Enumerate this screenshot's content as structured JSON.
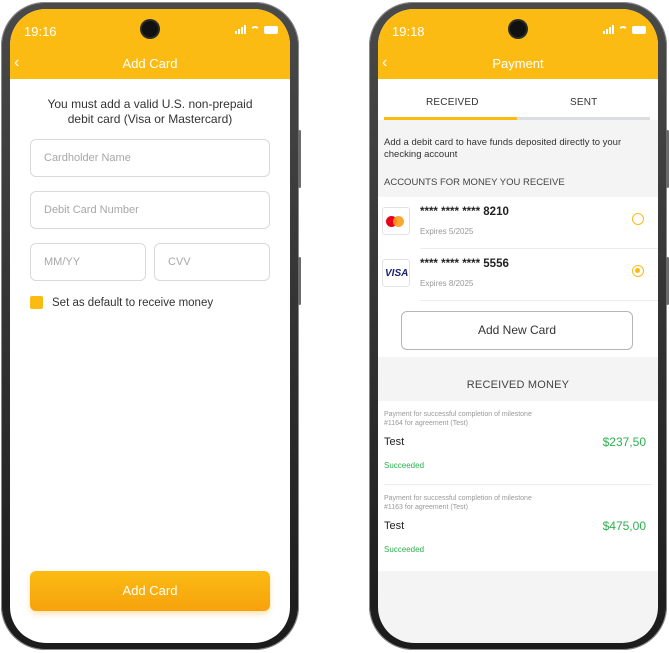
{
  "colors": {
    "accent": "#fbbb13",
    "success": "#2bb24c"
  },
  "add_card_screen": {
    "status_time": "19:16",
    "back_icon": "chevron-left-icon",
    "title": "Add Card",
    "notice": "You must add a valid U.S. non-prepaid debit card (Visa or Mastercard)",
    "fields": {
      "cardholder_placeholder": "Cardholder Name",
      "card_number_placeholder": "Debit Card Number",
      "expiry_placeholder": "MM/YY",
      "cvv_placeholder": "CVV"
    },
    "default_checkbox_label": "Set as default to receive money",
    "submit_label": "Add Card"
  },
  "payment_screen": {
    "status_time": "19:18",
    "back_icon": "chevron-left-icon",
    "title": "Payment",
    "tabs": [
      {
        "label": "RECEIVED",
        "active": true
      },
      {
        "label": "SENT",
        "active": false
      }
    ],
    "info_text": "Add a debit card to have funds deposited directly to your checking account",
    "accounts_label": "ACCOUNTS FOR MONEY YOU RECEIVE",
    "cards": [
      {
        "brand": "mastercard",
        "masked_number": "**** **** **** 8210",
        "expires": "Expires 5/2025",
        "selected": false
      },
      {
        "brand": "visa",
        "brand_text": "VISA",
        "masked_number": "**** **** **** 5556",
        "expires": "Expires 8/2025",
        "selected": true
      }
    ],
    "add_card_label": "Add New Card",
    "received_title": "RECEIVED MONEY",
    "transactions": [
      {
        "description": "Payment for successful completion of milestone #1164 for agreement (Test)",
        "name": "Test",
        "amount": "$237,50",
        "status": "Succeeded"
      },
      {
        "description": "Payment for successful completion of milestone #1163 for agreement (Test)",
        "name": "Test",
        "amount": "$475,00",
        "status": "Succeeded"
      }
    ]
  }
}
